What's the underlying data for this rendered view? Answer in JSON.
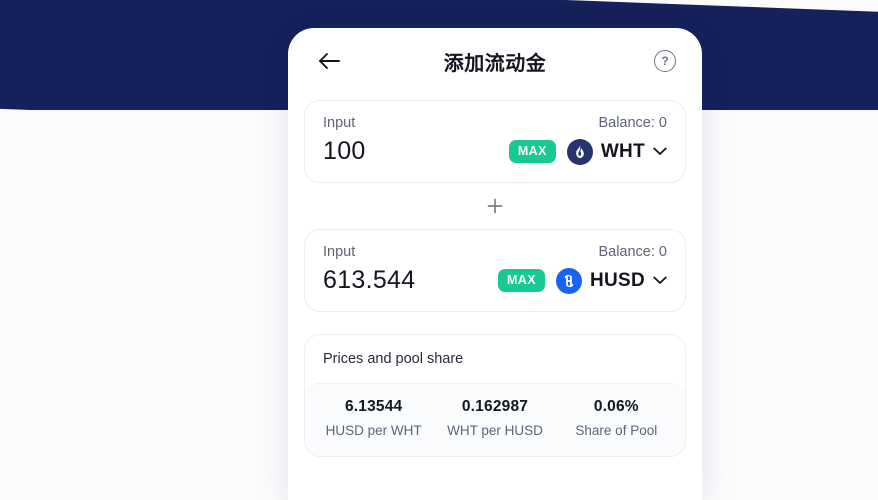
{
  "theme": {
    "banner_navy": "#16205a",
    "accent_teal": "#17c995",
    "husd_blue": "#1a63f0",
    "wht_navy": "#2a3270",
    "page_bg": "#fbfbfc"
  },
  "header": {
    "title": "添加流动金",
    "back_icon": "arrow-left-icon",
    "help_icon": "help-circle-icon",
    "help_glyph": "?"
  },
  "separator": {
    "glyph": "+"
  },
  "inputs": [
    {
      "label": "Input",
      "balance": "Balance: 0",
      "amount": "100",
      "max_label": "MAX",
      "token_symbol": "WHT",
      "token_icon": "wht-flame-icon",
      "chevron_icon": "chevron-down-icon"
    },
    {
      "label": "Input",
      "balance": "Balance: 0",
      "amount": "613.544",
      "max_label": "MAX",
      "token_symbol": "HUSD",
      "token_icon": "husd-icon",
      "chevron_icon": "chevron-down-icon"
    }
  ],
  "prices": {
    "title": "Prices and pool share",
    "stats": [
      {
        "value": "6.13544",
        "caption": "HUSD per WHT"
      },
      {
        "value": "0.162987",
        "caption": "WHT per HUSD"
      },
      {
        "value": "0.06%",
        "caption": "Share of Pool"
      }
    ]
  }
}
